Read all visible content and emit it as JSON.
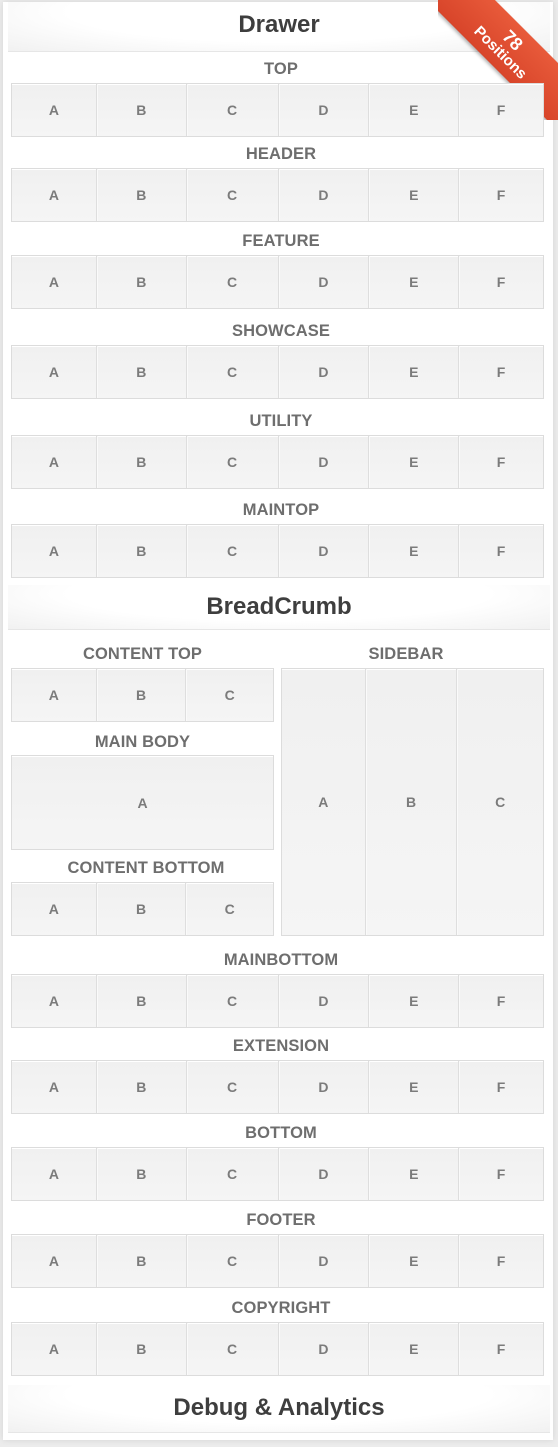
{
  "sections": {
    "drawer": "Drawer",
    "breadcrumb": "BreadCrumb",
    "debug": "Debug & Analytics"
  },
  "ribbon": {
    "count": "78",
    "label": "Positions",
    "color": "#e04e30"
  },
  "rows_top": [
    {
      "label": "TOP",
      "cells": [
        "A",
        "B",
        "C",
        "D",
        "E",
        "F"
      ]
    },
    {
      "label": "HEADER",
      "cells": [
        "A",
        "B",
        "C",
        "D",
        "E",
        "F"
      ]
    },
    {
      "label": "FEATURE",
      "cells": [
        "A",
        "B",
        "C",
        "D",
        "E",
        "F"
      ]
    },
    {
      "label": "SHOWCASE",
      "cells": [
        "A",
        "B",
        "C",
        "D",
        "E",
        "F"
      ]
    },
    {
      "label": "UTILITY",
      "cells": [
        "A",
        "B",
        "C",
        "D",
        "E",
        "F"
      ]
    },
    {
      "label": "MAINTOP",
      "cells": [
        "A",
        "B",
        "C",
        "D",
        "E",
        "F"
      ]
    }
  ],
  "main": {
    "content_top": {
      "label": "CONTENT TOP",
      "cells": [
        "A",
        "B",
        "C"
      ]
    },
    "main_body": {
      "label": "MAIN BODY",
      "cells": [
        "A"
      ]
    },
    "content_bottom": {
      "label": "CONTENT BOTTOM",
      "cells": [
        "A",
        "B",
        "C"
      ]
    },
    "sidebar": {
      "label": "SIDEBAR",
      "cells": [
        "A",
        "B",
        "C"
      ]
    }
  },
  "rows_bottom": [
    {
      "label": "MAINBOTTOM",
      "cells": [
        "A",
        "B",
        "C",
        "D",
        "E",
        "F"
      ]
    },
    {
      "label": "EXTENSION",
      "cells": [
        "A",
        "B",
        "C",
        "D",
        "E",
        "F"
      ]
    },
    {
      "label": "BOTTOM",
      "cells": [
        "A",
        "B",
        "C",
        "D",
        "E",
        "F"
      ]
    },
    {
      "label": "FOOTER",
      "cells": [
        "A",
        "B",
        "C",
        "D",
        "E",
        "F"
      ]
    },
    {
      "label": "COPYRIGHT",
      "cells": [
        "A",
        "B",
        "C",
        "D",
        "E",
        "F"
      ]
    }
  ]
}
